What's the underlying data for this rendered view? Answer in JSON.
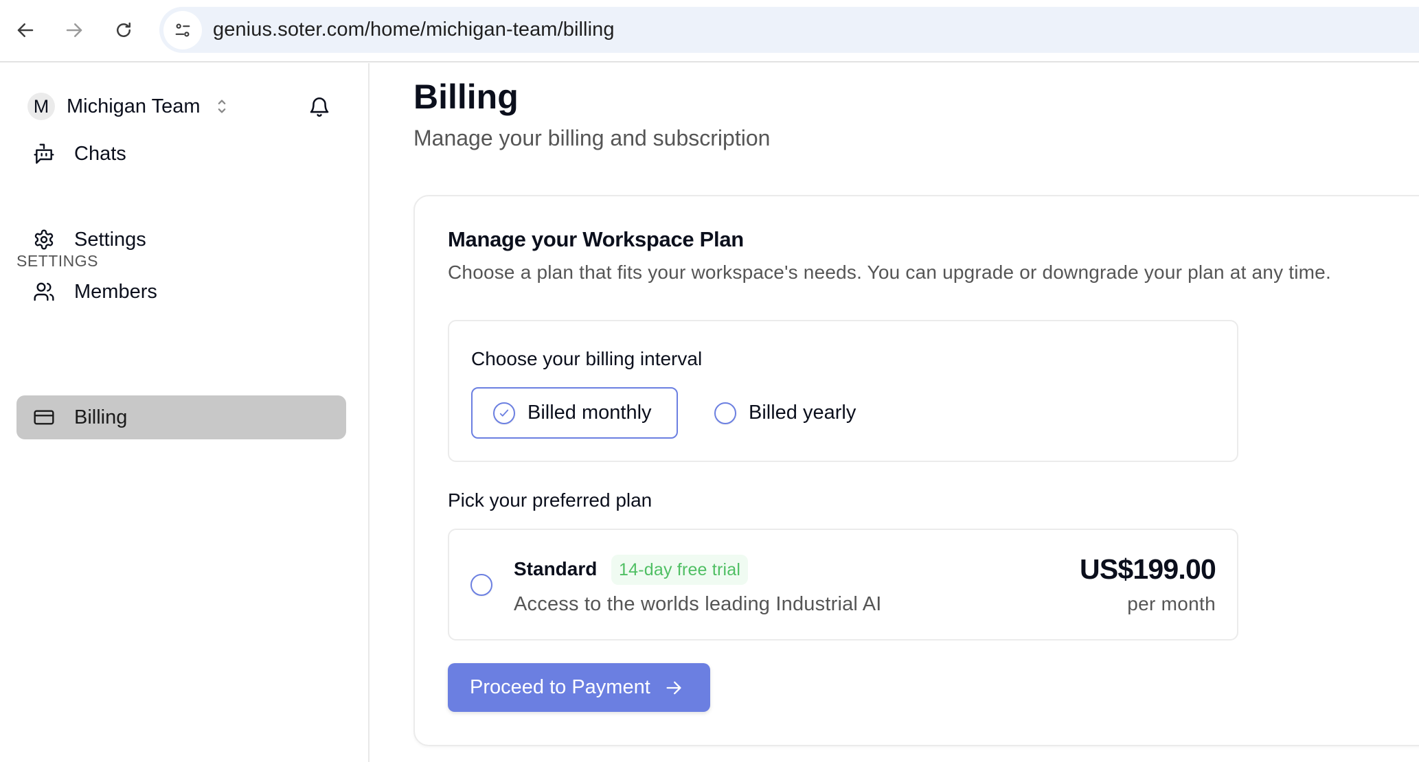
{
  "browser": {
    "url": "genius.soter.com/home/michigan-team/billing"
  },
  "sidebar": {
    "team": {
      "avatar_initial": "M",
      "name": "Michigan Team"
    },
    "items": [
      {
        "label": "Chats",
        "icon": "bot-message-icon",
        "active": false
      }
    ],
    "section_label": "SETTINGS",
    "settings_items": [
      {
        "label": "Settings",
        "icon": "gear-icon",
        "active": false
      },
      {
        "label": "Members",
        "icon": "users-icon",
        "active": false
      },
      {
        "label": "Billing",
        "icon": "credit-card-icon",
        "active": true
      }
    ]
  },
  "page": {
    "title": "Billing",
    "subtitle": "Manage your billing and subscription"
  },
  "plan_card": {
    "title": "Manage your Workspace Plan",
    "description": "Choose a plan that fits your workspace's needs. You can upgrade or downgrade your plan at any time.",
    "interval": {
      "heading": "Choose your billing interval",
      "options": [
        {
          "label": "Billed monthly",
          "selected": true
        },
        {
          "label": "Billed yearly",
          "selected": false
        }
      ]
    },
    "plans": {
      "heading": "Pick your preferred plan",
      "items": [
        {
          "name": "Standard",
          "badge": "14-day free trial",
          "description": "Access to the worlds leading Industrial AI",
          "price": "US$199.00",
          "period": "per month",
          "selected": false
        }
      ]
    },
    "proceed_label": "Proceed to Payment"
  },
  "colors": {
    "accent": "#6b7fe1",
    "badge_text": "#4fbf63",
    "badge_bg": "#f0fbf2",
    "active_nav_bg": "#c8c8c8",
    "address_bar_bg": "#edf2fa"
  }
}
